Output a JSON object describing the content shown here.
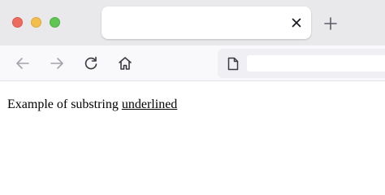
{
  "window": {
    "traffic_lights": {
      "close_color": "#ed6a5e",
      "minimize_color": "#f4be4f",
      "maximize_color": "#61c554"
    }
  },
  "tab": {
    "title": "",
    "close_icon": "close-icon"
  },
  "new_tab_icon": "plus-icon",
  "toolbar": {
    "back_icon": "arrow-left-icon",
    "forward_icon": "arrow-right-icon",
    "reload_icon": "reload-icon",
    "home_icon": "home-icon"
  },
  "urlbar": {
    "page_icon": "document-icon",
    "value": ""
  },
  "page": {
    "text_prefix": "Example of substring ",
    "text_underlined": "underlined"
  }
}
